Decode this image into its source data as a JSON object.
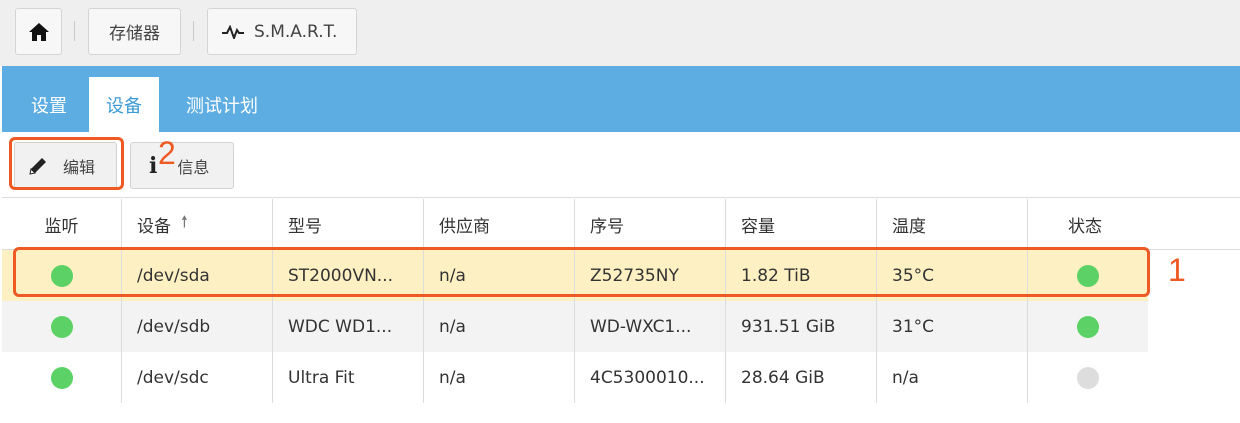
{
  "breadcrumb": {
    "home_icon": "home-icon",
    "storage_label": "存储器",
    "smart_icon": "pulse-icon",
    "smart_label": "S.M.A.R.T."
  },
  "tabs": [
    {
      "label": "设置",
      "active": false
    },
    {
      "label": "设备",
      "active": true
    },
    {
      "label": "测试计划",
      "active": false
    }
  ],
  "toolbar": {
    "edit_icon": "pencil-icon",
    "edit_label": "编辑",
    "info_icon": "info-icon",
    "info_label": "信息"
  },
  "table": {
    "columns": [
      "监听",
      "设备",
      "型号",
      "供应商",
      "序号",
      "容量",
      "温度",
      "状态"
    ],
    "sort_column": "设备",
    "rows": [
      {
        "monitor": "green",
        "device": "/dev/sda",
        "model": "ST2000VN...",
        "vendor": "n/a",
        "serial": "Z52735NY",
        "capacity": "1.82 TiB",
        "temperature": "35°C",
        "status": "green",
        "selected": true
      },
      {
        "monitor": "green",
        "device": "/dev/sdb",
        "model": "WDC WD1...",
        "vendor": "n/a",
        "serial": "WD-WXC1...",
        "capacity": "931.51 GiB",
        "temperature": "31°C",
        "status": "green",
        "selected": false
      },
      {
        "monitor": "green",
        "device": "/dev/sdc",
        "model": "Ultra Fit",
        "vendor": "n/a",
        "serial": "4C5300010...",
        "capacity": "28.64 GiB",
        "temperature": "n/a",
        "status": "grey",
        "selected": false
      }
    ]
  },
  "annotations": {
    "label_1": "1",
    "label_2": "2",
    "color": "#ee5a24"
  },
  "colors": {
    "tab_bar": "#5dade2",
    "active_tab_text": "#3e9bd6",
    "selected_row": "#fdf0c2",
    "status_ok": "#5cd165",
    "status_unknown": "#dddddd"
  }
}
